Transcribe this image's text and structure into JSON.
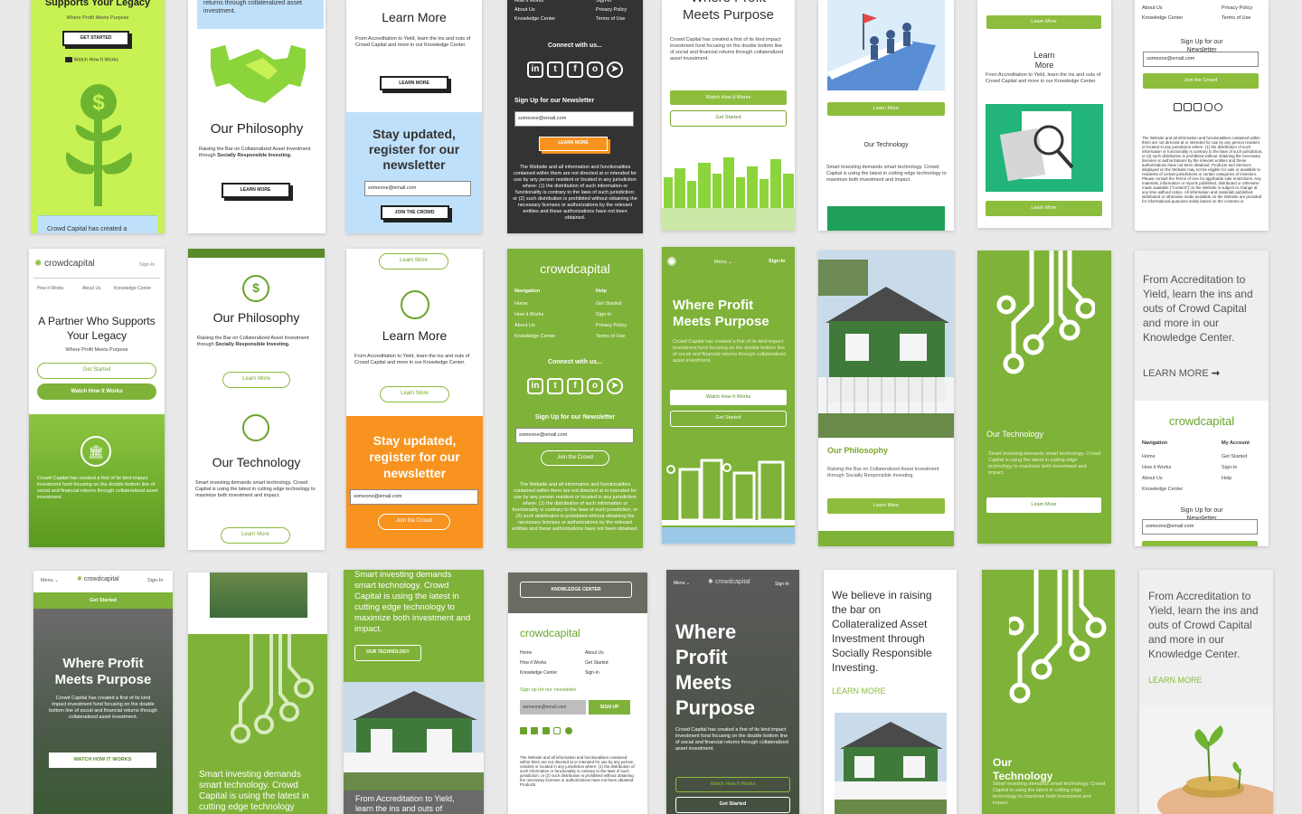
{
  "brand": {
    "name": "crowdcapital",
    "green": "#8cbd3c",
    "dark_green": "#5a8a2c",
    "dark": "#333333"
  },
  "common": {
    "legacy_title": "A Partner Who Supports Your Legacy",
    "legacy_title_cut": "Supports Your Legacy",
    "legacy_sub": "Where Profit Meets Purpose",
    "get_started_upper": "GET STARTED",
    "get_started": "Get Started",
    "watch_upper": "Watch How It Works",
    "watch": "Watch How It Works",
    "watch_caps": "WATCH HOW IT WORKS",
    "crowd_intro": "Crowd Capital has created a",
    "crowd_full": "Crowd Capital has created a first of its kind impact investment fund focusing on the double bottom line of social and financial returns through collateralized asset investment.",
    "returns_tail": "returns through collateralized asset investment.",
    "philosophy": "Our Philosophy",
    "philosophy_text": "Raising the Bar on Collateralized Asset Investment through",
    "philosophy_bold": "Socially Responsible Investing.",
    "learn_more": "Learn More",
    "learn_more_upper": "LEARN MORE",
    "learn_more_arrow": "LEARN MORE",
    "learn_text": "From Accreditation to Yield, learn the ins and outs of Crowd Capital and more in our Knowledge Center.",
    "learn_text_cut": "From Accreditation to Yield, learn the ins and outs of",
    "learn_heading_split": "Learn More",
    "stay": "Stay updated, register for our newsletter",
    "email": "someone@email.com",
    "join_upper": "JOIN THE CROWD",
    "join": "Join the Crowd",
    "connect": "Connect with us...",
    "signup": "Sign Up for our Newsletter",
    "signup_lower": "Sign up for our newsletter",
    "signup_btn": "SIGN UP",
    "where": "Where Profit Meets Purpose",
    "technology": "Our Technology",
    "tech_text": "Smart investing demands smart technology. Crowd Capital is using the latest in cutting edge technology to maximize both investment and impact.",
    "tech_text_cut": "Smart investing demands smart technology. Crowd Capital is using the latest in cutting edge technology",
    "tech_text_top": "Smart investing demands smart technology. Crowd Capital is using the latest in cutting edge technology to maximize both investment and impact.",
    "our_tech_btn": "OUR TECHNOLOGY",
    "believe": "We believe in raising the bar on Collateralized Asset Investment through Socially Responsible Investing.",
    "knowledge_center_btn": "KNOWLEDGE CENTER",
    "sign_in": "Sign-In",
    "menu": "Menu",
    "nav_how": "How it Works",
    "nav_about": "About Us",
    "nav_kc": "Knowledge Center",
    "navigation": "Navigation",
    "help": "Help",
    "my_account": "My Account",
    "home": "Home",
    "privacy": "Privacy Policy",
    "terms": "Terms of Use",
    "disclaimer": "The Website and all information and functionalities contained within them are not directed at or intended for use by any person resident or located in any jurisdiction where: (1) the distribution of such information or functionality is contrary to the laws of such jurisdiction; or (2) such distribution is prohibited without obtaining the necessary licenses or authorizations by the relevant entities and these authorizations have not been obtained.",
    "disclaimer_cut": "The Website and all information and functionalities contained within them are not directed at or intended for use by any person resident or located in any jurisdiction where: (1) the distribution of such information or functionality is contrary to the laws of such jurisdiction; or (2) such distribution is prohibited without obtaining the necessary licenses or authorizations have not been obtained. Products",
    "disclaimer_long": "The Website and all information and functionalities contained within them are not directed at or intended for use by any person resident or located in any jurisdiction where: (1) the distribution of such information or functionality is contrary to the laws of such jurisdiction; or (2) such distribution is prohibited without obtaining the necessary licenses or authorizations by the relevant entities and these authorizations have not been obtained. Products and Services displayed on the Website may not be eligible for sale or available to residents of certain jurisdictions or certain categories of investors. Please consult the Terms of Use for applicable sale restrictions. Any materials, information or reports published, distributed or otherwise made available (\"Content\") on the Website is subject to change at any time without notice. All information and materials published, distributed or otherwise made available on the Website are provided for informational purposes solely based on the contents or"
  }
}
